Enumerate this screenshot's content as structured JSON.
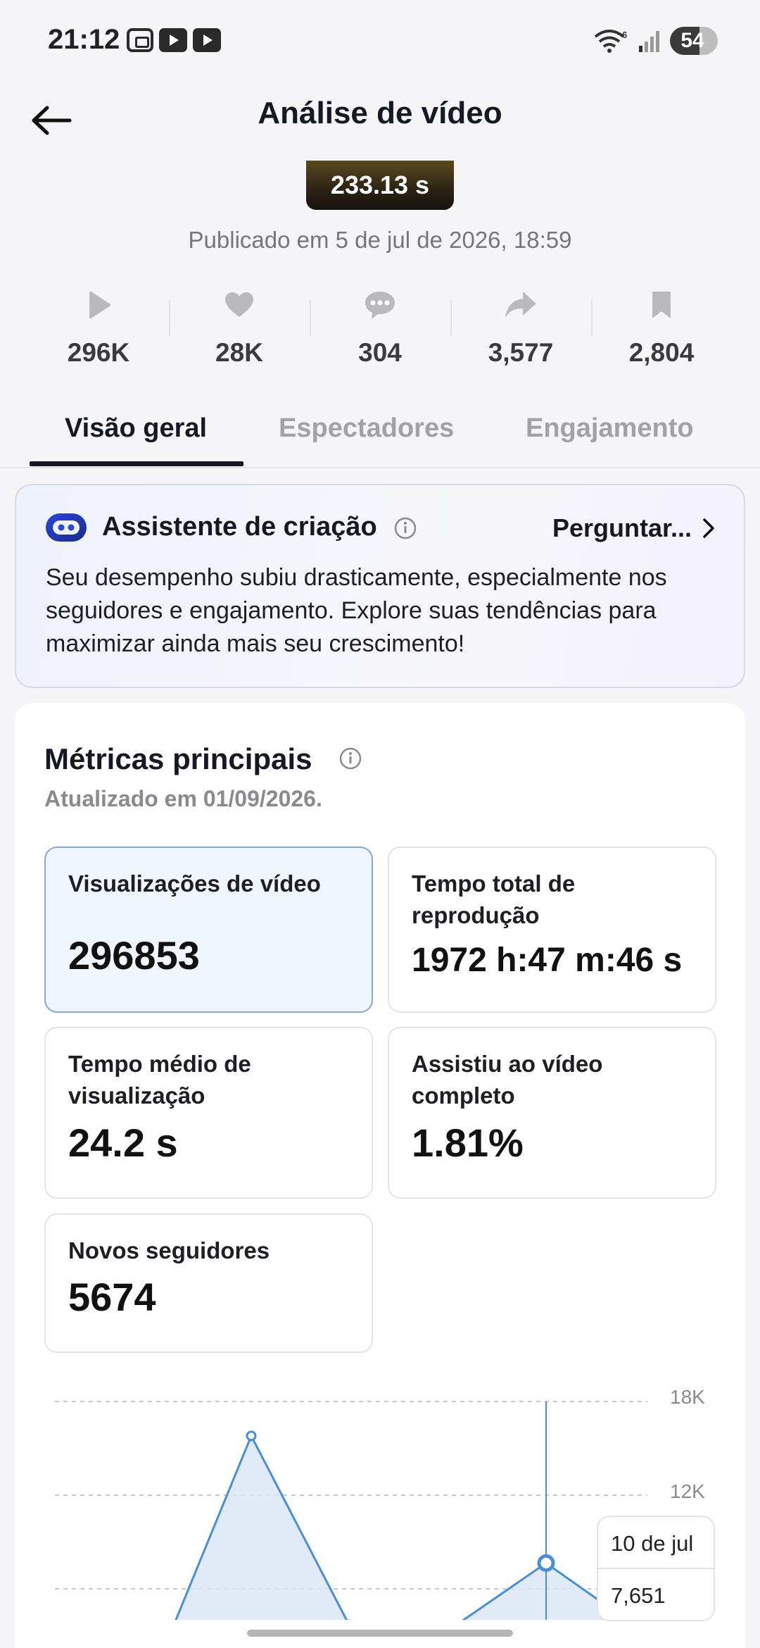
{
  "status_bar": {
    "time": "21:12",
    "battery": "54"
  },
  "header": {
    "title": "Análise de vídeo"
  },
  "video": {
    "duration": "233.13 s",
    "published": "Publicado em 5 de jul de 2026, 18:59"
  },
  "stats": [
    {
      "icon": "play-icon",
      "value": "296K"
    },
    {
      "icon": "heart-icon",
      "value": "28K"
    },
    {
      "icon": "comment-icon",
      "value": "304"
    },
    {
      "icon": "share-icon",
      "value": "3,577"
    },
    {
      "icon": "bookmark-icon",
      "value": "2,804"
    }
  ],
  "tabs": [
    {
      "label": "Visão geral",
      "active": true
    },
    {
      "label": "Espectadores",
      "active": false
    },
    {
      "label": "Engajamento",
      "active": false
    }
  ],
  "assistant": {
    "title": "Assistente de criação",
    "ask_label": "Perguntar...",
    "text": "Seu desempenho subiu drasticamente, especialmente nos seguidores e engajamento. Explore suas tendências para maximizar ainda mais seu crescimento!"
  },
  "metrics": {
    "title": "Métricas principais",
    "updated": "Atualizado em 01/09/2026.",
    "tiles": [
      {
        "label": "Visualizações de vídeo",
        "value": "296853",
        "selected": true
      },
      {
        "label": "Tempo total de reprodução",
        "value": "1972 h:47 m:46 s",
        "selected": false
      },
      {
        "label": "Tempo médio de visualização",
        "value": "24.2 s",
        "selected": false
      },
      {
        "label": "Assistiu ao vídeo completo",
        "value": "1.81%",
        "selected": false
      },
      {
        "label": "Novos seguidores",
        "value": "5674",
        "selected": false
      }
    ]
  },
  "chart_data": {
    "type": "area",
    "y_ticks": [
      "18K",
      "12K"
    ],
    "ylim": [
      0,
      18000
    ],
    "points": [
      {
        "y": 0
      },
      {
        "y": 500
      },
      {
        "y": 15800
      },
      {
        "y": 3700
      },
      {
        "y": 3300
      },
      {
        "y": 7651
      },
      {
        "y": 3200
      }
    ],
    "selected_index": 5,
    "tooltip": {
      "date": "10 de jul",
      "value": "7,651"
    },
    "accent_color": "#4a8fd4",
    "fill_color": "#dbe7f6"
  }
}
